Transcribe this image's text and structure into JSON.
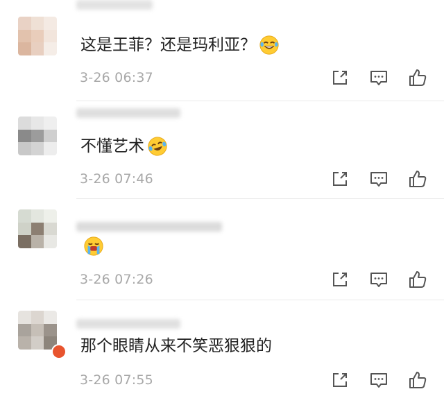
{
  "comments": [
    {
      "text": "这是王菲？还是玛利亚？",
      "time": "3-26 06:37",
      "emoji": "laugh-cry-emoji"
    },
    {
      "text": "不懂艺术",
      "time": "3-26 07:46",
      "emoji": "crying-laughing-tilted-emoji"
    },
    {
      "text": "",
      "time": "3-26 07:26",
      "emoji": "crying-emoji"
    },
    {
      "text": "那个眼睛从来不笑恶狠狠的",
      "time": "3-26 07:55",
      "emoji": ""
    }
  ],
  "actions": {
    "share": "share-icon",
    "reply": "comment-icon",
    "like": "thumbs-up-icon"
  },
  "colors": {
    "text": "#222222",
    "time": "#a8a8a8",
    "icon": "#555555",
    "divider": "#e9e9e9"
  }
}
